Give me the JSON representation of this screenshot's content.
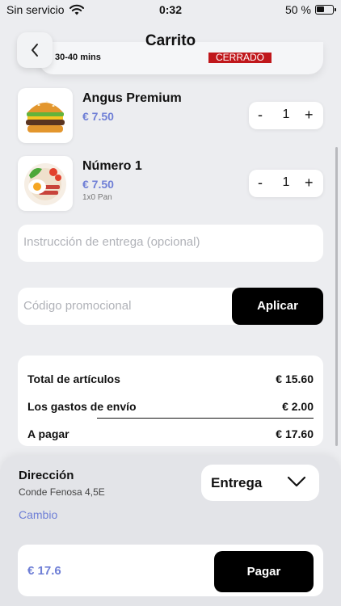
{
  "status_bar": {
    "carrier": "Sin servicio",
    "time": "0:32",
    "battery": "50 %"
  },
  "header": {
    "title": "Carrito"
  },
  "store": {
    "delivery_time": "30-40 mins",
    "status": "CERRADO"
  },
  "cart": {
    "items": [
      {
        "name": "Angus Premium",
        "price": "€ 7.50",
        "quantity": "1",
        "variant": "",
        "icon": "burger-icon"
      },
      {
        "name": "Número 1",
        "price": "€ 7.50",
        "quantity": "1",
        "variant": "1x0 Pan",
        "icon": "breakfast-plate-icon"
      }
    ],
    "stepper": {
      "minus": "-",
      "plus": "+"
    }
  },
  "delivery_instructions": {
    "placeholder": "Instrucción de entrega (opcional)"
  },
  "promo": {
    "placeholder": "Código promocional",
    "apply_label": "Aplicar"
  },
  "summary": {
    "items_total_label": "Total de artículos",
    "items_total": "€ 15.60",
    "shipping_label": "Los gastos de envío",
    "shipping": "€ 2.00",
    "to_pay_label": "A pagar",
    "to_pay": "€ 17.60"
  },
  "address": {
    "label": "Dirección",
    "value": "Conde Fenosa 4,5E",
    "change_label": "Cambio"
  },
  "delivery_mode": {
    "selected": "Entrega"
  },
  "payment": {
    "total": "€ 17.6",
    "pay_label": "Pagar"
  },
  "colors": {
    "accent": "#6f7fd6",
    "closed_badge": "#c0171b",
    "button": "#000000"
  }
}
